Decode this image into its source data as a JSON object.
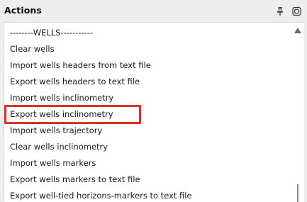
{
  "panel": {
    "title": "Actions",
    "pin_icon": "pin-icon",
    "float_icon": "float-window-icon"
  },
  "actions": {
    "items": [
      {
        "label": "--------WELLS-----------"
      },
      {
        "label": "Clear wells"
      },
      {
        "label": "Import wells headers from text file"
      },
      {
        "label": "Export wells headers to text file"
      },
      {
        "label": "Import wells inclinometry"
      },
      {
        "label": "Export wells inclinometry",
        "highlighted": true
      },
      {
        "label": "Import wells trajectory"
      },
      {
        "label": "Clear wells inclinometry"
      },
      {
        "label": "Import wells markers"
      },
      {
        "label": "Export wells markers to text file"
      },
      {
        "label": "Export well-tied horizons-markers to text file"
      }
    ]
  },
  "colors": {
    "highlight": "#d9342b",
    "panel_bg": "#eeeeee",
    "list_bg": "#ffffff"
  }
}
